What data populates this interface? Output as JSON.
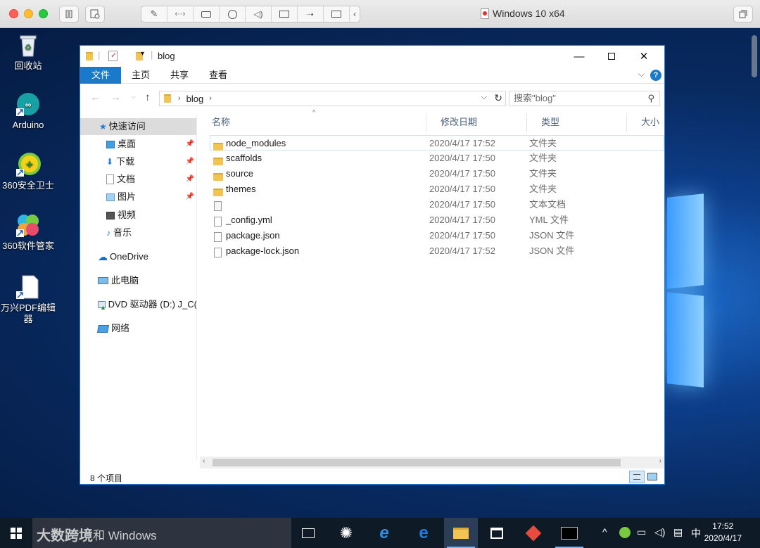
{
  "mac": {
    "window_title": "Windows 10 x64"
  },
  "desktop": {
    "icons": [
      {
        "label": "回收站",
        "icon": "recycle-bin-icon"
      },
      {
        "label": "Arduino",
        "icon": "arduino-icon"
      },
      {
        "label": "360安全卫士",
        "icon": "360-safe-icon"
      },
      {
        "label": "360软件管家",
        "icon": "360-software-icon"
      },
      {
        "label": "万兴PDF编辑器",
        "icon": "pdf-editor-icon"
      }
    ]
  },
  "explorer": {
    "title": "blog",
    "ribbon_tabs": [
      "文件",
      "主页",
      "共享",
      "查看"
    ],
    "address_path": "blog",
    "search_placeholder": "搜索\"blog\"",
    "nav": {
      "quick_access": "快速访问",
      "pinned": [
        "桌面",
        "下载",
        "文档",
        "图片"
      ],
      "unpinned": [
        "视频",
        "音乐"
      ],
      "onedrive": "OneDrive",
      "this_pc": "此电脑",
      "dvd": "DVD 驱动器 (D:) J_C(",
      "network": "网络"
    },
    "columns": {
      "name": "名称",
      "modified": "修改日期",
      "type": "类型",
      "size": "大小"
    },
    "files": [
      {
        "name": "node_modules",
        "date": "2020/4/17 17:52",
        "type": "文件夹",
        "kind": "folder"
      },
      {
        "name": "scaffolds",
        "date": "2020/4/17 17:50",
        "type": "文件夹",
        "kind": "folder"
      },
      {
        "name": "source",
        "date": "2020/4/17 17:50",
        "type": "文件夹",
        "kind": "folder"
      },
      {
        "name": "themes",
        "date": "2020/4/17 17:50",
        "type": "文件夹",
        "kind": "folder"
      },
      {
        "name": "",
        "date": "2020/4/17 17:50",
        "type": "文本文档",
        "kind": "text"
      },
      {
        "name": "_config.yml",
        "date": "2020/4/17 17:50",
        "type": "YML 文件",
        "kind": "file"
      },
      {
        "name": "package.json",
        "date": "2020/4/17 17:50",
        "type": "JSON 文件",
        "kind": "file"
      },
      {
        "name": "package-lock.json",
        "date": "2020/4/17 17:52",
        "type": "JSON 文件",
        "kind": "file"
      }
    ],
    "status": "8 个项目"
  },
  "taskbar": {
    "search_text": "和 Windows",
    "watermark": "大数跨境",
    "tray_lang": "中",
    "time": "17:52",
    "date": "2020/4/17"
  }
}
